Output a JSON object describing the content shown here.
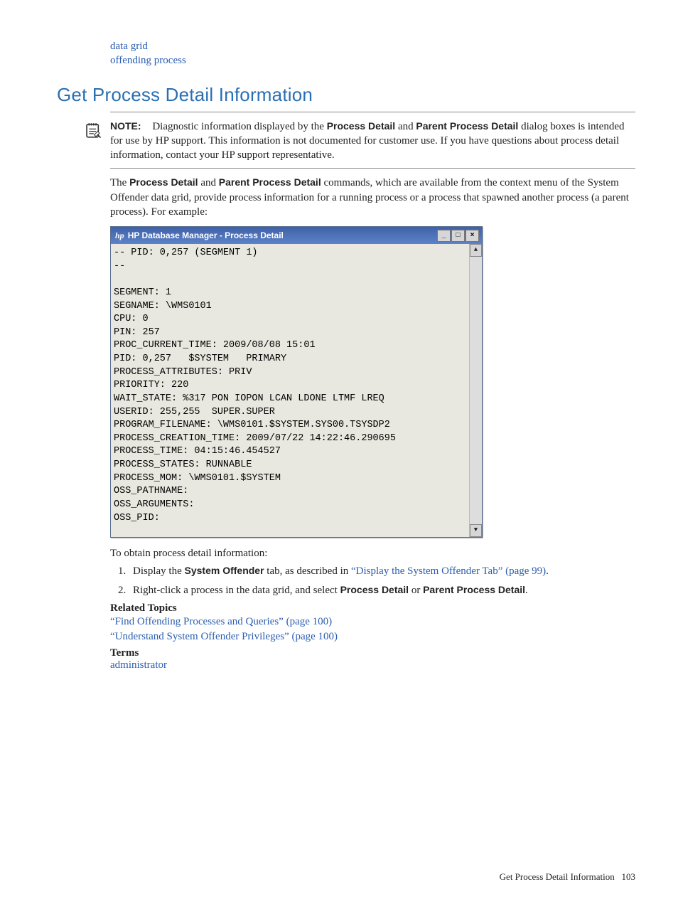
{
  "prelinks": {
    "l1": "data grid",
    "l2": "offending process"
  },
  "heading": "Get Process Detail Information",
  "note": {
    "label": "NOTE:",
    "t1": "Diagnostic information displayed by the ",
    "b1": "Process Detail",
    "t2": " and ",
    "b2": "Parent Process Detail",
    "t3": " dialog boxes is intended for use by HP support. This information is not documented for customer use. If you have questions about process detail information, contact your HP support representative."
  },
  "para1": {
    "t1": "The ",
    "b1": "Process Detail",
    "t2": " and ",
    "b2": "Parent Process Detail",
    "t3": " commands, which are available from the context menu of the System Offender data grid, provide process information for a running process or a process that spawned another process (a parent process). For example:"
  },
  "dialog": {
    "logo": "hp",
    "title": "HP Database Manager - Process Detail",
    "content": "-- PID: 0,257 (SEGMENT 1)\n--\n\nSEGMENT: 1\nSEGNAME: \\WMS0101\nCPU: 0\nPIN: 257\nPROC_CURRENT_TIME: 2009/08/08 15:01\nPID: 0,257   $SYSTEM   PRIMARY\nPROCESS_ATTRIBUTES: PRIV\nPRIORITY: 220\nWAIT_STATE: %317 PON IOPON LCAN LDONE LTMF LREQ\nUSERID: 255,255  SUPER.SUPER\nPROGRAM_FILENAME: \\WMS0101.$SYSTEM.SYS00.TSYSDP2\nPROCESS_CREATION_TIME: 2009/07/22 14:22:46.290695\nPROCESS_TIME: 04:15:46.454527\nPROCESS_STATES: RUNNABLE\nPROCESS_MOM: \\WMS0101.$SYSTEM\nOSS_PATHNAME:\nOSS_ARGUMENTS:\nOSS_PID:"
  },
  "intro": "To obtain process detail information:",
  "steps": {
    "s1_t1": "Display the ",
    "s1_b1": "System Offender",
    "s1_t2": " tab, as described in ",
    "s1_link": "“Display the System Offender Tab” (page 99)",
    "s1_t3": ".",
    "s2_t1": "Right-click a process in the data grid, and select ",
    "s2_b1": "Process Detail",
    "s2_t2": " or ",
    "s2_b2": "Parent Process Detail",
    "s2_t3": "."
  },
  "related_head": "Related Topics",
  "related": {
    "r1": "“Find Offending Processes and Queries” (page 100)",
    "r2": "“Understand System Offender Privileges” (page 100)"
  },
  "terms_head": "Terms",
  "terms": {
    "t1": "administrator"
  },
  "footer": {
    "title": "Get Process Detail Information",
    "page": "103"
  }
}
